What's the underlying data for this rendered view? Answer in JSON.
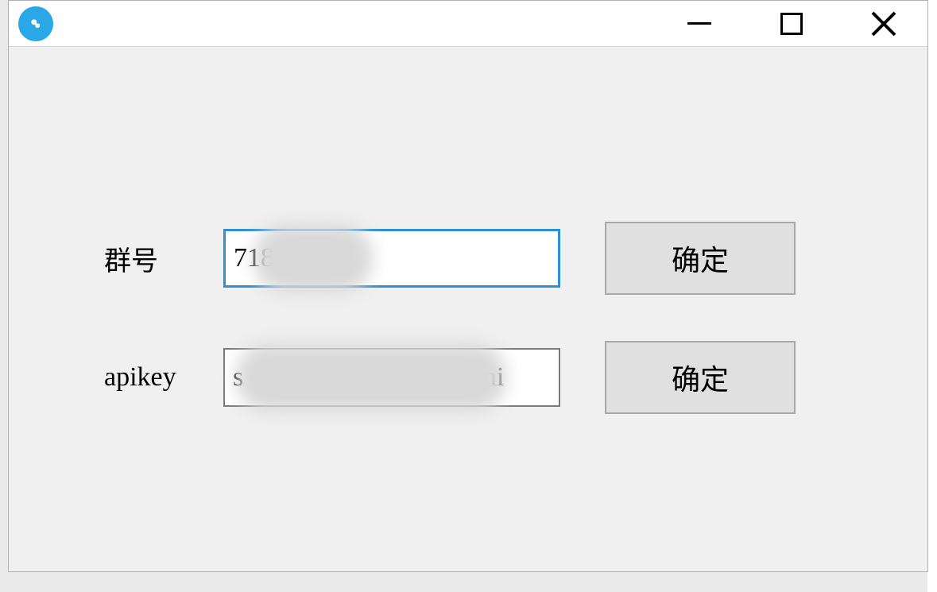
{
  "window": {
    "icon_name": "chat-bubble-icon"
  },
  "form": {
    "group": {
      "label": "群号",
      "value": "718",
      "confirm_label": "确定"
    },
    "apikey": {
      "label": "apikey",
      "value": "s                              VJmi",
      "confirm_label": "确定"
    }
  }
}
